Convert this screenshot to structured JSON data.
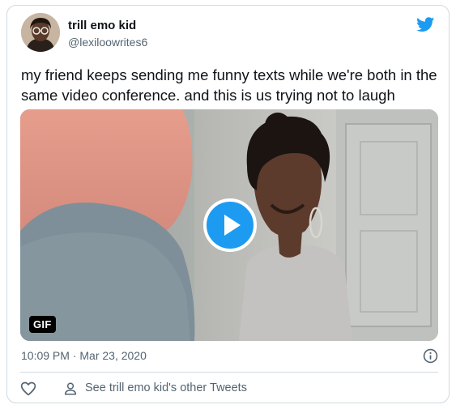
{
  "tweet": {
    "author_name": "trill emo kid",
    "author_handle": "@lexiloowrites6",
    "text": "my friend keeps sending me funny texts while we're both in the same video conference. and this is us trying not to laugh",
    "timestamp": "10:09 PM · Mar 23, 2020",
    "media_badge": "GIF",
    "other_tweets_link": "See trill emo kid's other Tweets"
  },
  "icons": {
    "logo": "twitter-bird-icon",
    "play": "play-icon",
    "info": "info-icon",
    "like": "heart-icon",
    "profile": "person-icon"
  },
  "colors": {
    "brand": "#1d9bf0",
    "text": "#0f1419",
    "secondary_text": "#536471",
    "border": "#cfd9de"
  }
}
